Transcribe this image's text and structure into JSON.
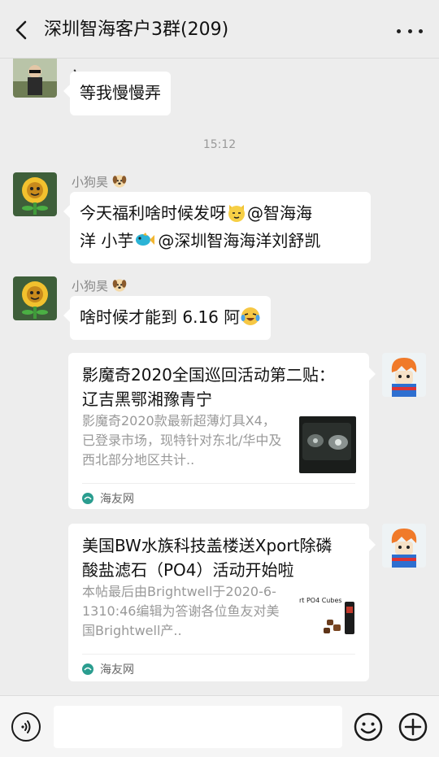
{
  "header": {
    "title": "深圳智海客户3群(209)",
    "back_icon": "chevron-left-icon",
    "more_icon": "ellipsis-icon"
  },
  "messages": {
    "partial_top": {
      "fragment": "，",
      "text": "等我慢慢弄"
    },
    "time": "15:12",
    "msg1": {
      "sender": "小狗昊",
      "line1_a": "今天福利啥时候发呀",
      "line1_b": "@智海海",
      "line2_a": "洋  小芋",
      "line2_b": "@深圳智海海洋刘舒凯"
    },
    "msg2": {
      "sender": "小狗昊",
      "text": "啥时候才能到 6.16 阿"
    },
    "card1": {
      "title": "影魔奇2020全国巡回活动第二贴： 辽吉黑鄂湘豫青宁",
      "desc": "影魔奇2020款最新超薄灯具X4，已登录市场，现特针对东北/华中及西北部分地区共计..",
      "source": "海友网"
    },
    "card2": {
      "title": "美国BW水族科技盖楼送Xport除磷酸盐滤石（PO4）活动开始啦",
      "desc": "本帖最后由Brightwell于2020-6-1310:46编辑为答谢各位鱼友对美国Brightwell产..",
      "thumb_text": "rt PO4 Cubes",
      "source": "海友网"
    }
  },
  "input": {
    "value": ""
  },
  "colors": {
    "bg": "#ededed",
    "bubble": "#ffffff",
    "meta": "#999999",
    "source_icon": "#2a9d8f"
  }
}
